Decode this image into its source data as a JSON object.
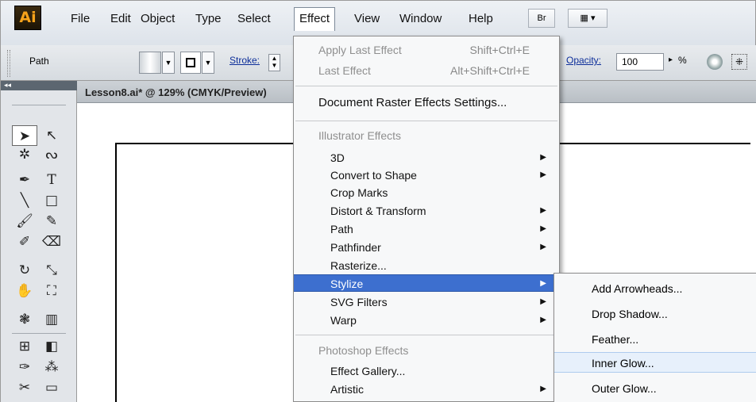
{
  "app": {
    "logo_text": "Ai"
  },
  "menubar": {
    "items": [
      "File",
      "Edit",
      "Object",
      "Type",
      "Select",
      "Effect",
      "View",
      "Window",
      "Help"
    ],
    "bridge_label": "Br"
  },
  "control": {
    "selection_label": "Path",
    "stroke_label": "Stroke:",
    "opacity_label": "Opacity:",
    "opacity_value": "100",
    "percent": "%"
  },
  "document": {
    "tab_title": "Lesson8.ai* @ 129% (CMYK/Preview)"
  },
  "effect_menu": {
    "apply_last": {
      "label": "Apply Last Effect",
      "shortcut": "Shift+Ctrl+E"
    },
    "last": {
      "label": "Last Effect",
      "shortcut": "Alt+Shift+Ctrl+E"
    },
    "raster_settings": "Document Raster Effects Settings...",
    "illustrator_header": "Illustrator Effects",
    "illustrator_items": [
      {
        "label": "3D",
        "submenu": true
      },
      {
        "label": "Convert to Shape",
        "submenu": true
      },
      {
        "label": "Crop Marks",
        "submenu": false
      },
      {
        "label": "Distort & Transform",
        "submenu": true
      },
      {
        "label": "Path",
        "submenu": true
      },
      {
        "label": "Pathfinder",
        "submenu": true
      },
      {
        "label": "Rasterize...",
        "submenu": false
      },
      {
        "label": "Stylize",
        "submenu": true
      },
      {
        "label": "SVG Filters",
        "submenu": true
      },
      {
        "label": "Warp",
        "submenu": true
      }
    ],
    "photoshop_header": "Photoshop Effects",
    "photoshop_items": [
      {
        "label": "Effect Gallery...",
        "submenu": false
      },
      {
        "label": "Artistic",
        "submenu": true
      }
    ]
  },
  "stylize_submenu": {
    "items": [
      "Add Arrowheads...",
      "Drop Shadow...",
      "Feather...",
      "Inner Glow...",
      "Outer Glow..."
    ]
  },
  "tools_panel": {
    "collapse_glyph": "◂◂"
  },
  "colors": {
    "highlight": "#3d6fcf",
    "hover": "#e7f0fb",
    "logo_bg": "#2b1d08",
    "logo_fg": "#f6a21a"
  }
}
